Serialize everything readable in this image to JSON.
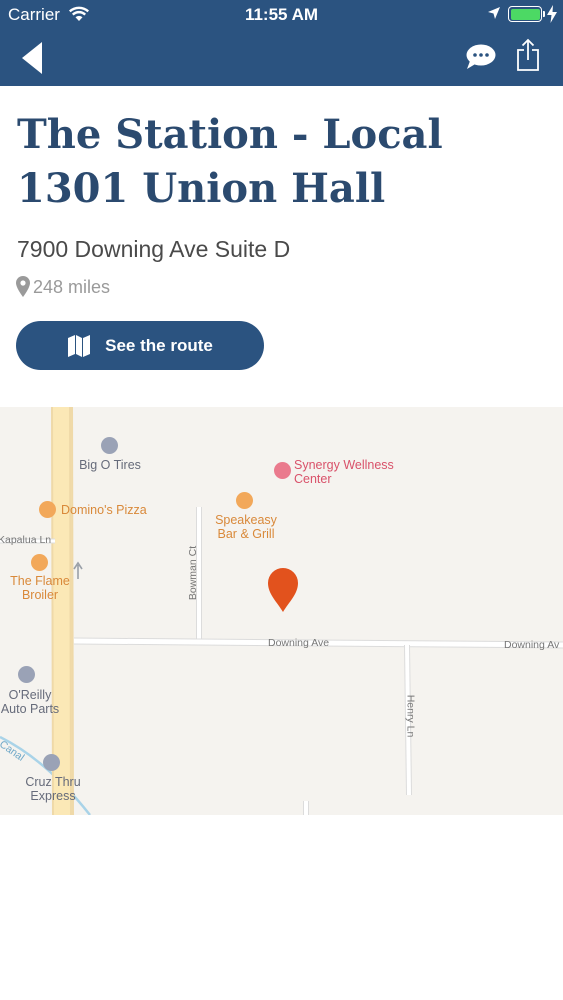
{
  "status_bar": {
    "carrier": "Carrier",
    "time": "11:55 AM",
    "battery_level": 1.0
  },
  "nav": {
    "back_icon": "chevron-left-icon",
    "chat_icon": "chat-bubble-icon",
    "share_icon": "share-icon"
  },
  "place": {
    "title": "The Station - Local 1301 Union Hall",
    "address": "7900 Downing Ave Suite D",
    "distance": "248 miles"
  },
  "route_button": {
    "label": "See the route",
    "icon": "map-icon"
  },
  "map": {
    "pois": [
      {
        "name": "Big O Tires",
        "type": "auto"
      },
      {
        "name": "Synergy Wellness Center",
        "type": "health"
      },
      {
        "name": "Domino's Pizza",
        "type": "food"
      },
      {
        "name": "Speakeasy Bar & Grill",
        "type": "food"
      },
      {
        "name": "The Flame Broiler",
        "type": "food"
      },
      {
        "name": "O'Reilly Auto Parts",
        "type": "auto"
      },
      {
        "name": "Cruz Thru Express",
        "type": "auto"
      }
    ],
    "streets": [
      "Kapalua Ln",
      "Bowman Ct",
      "Downing Ave",
      "Downing Av",
      "Henry Ln",
      "Canal"
    ]
  },
  "colors": {
    "brand": "#2b5380",
    "title": "#2b4a6f",
    "marker": "#e2521d",
    "battery": "#4cd964"
  }
}
